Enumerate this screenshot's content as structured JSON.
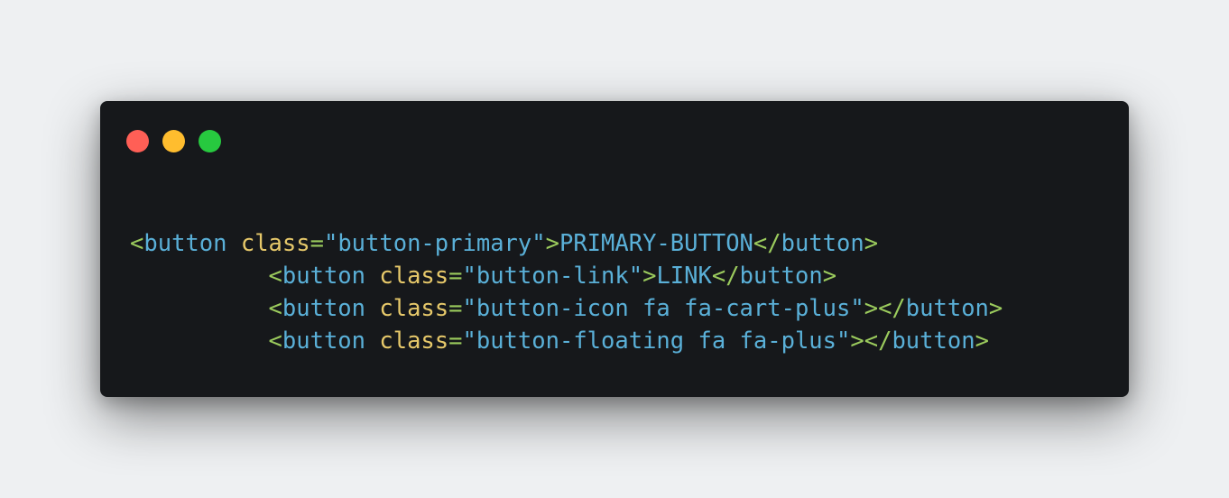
{
  "window": {
    "controls": {
      "close_color": "#ff5f56",
      "minimize_color": "#ffbd2e",
      "maximize_color": "#27c93f"
    }
  },
  "code": {
    "lines": [
      {
        "indent": "",
        "tag": "button",
        "attr": "class",
        "value": "\"button-primary\"",
        "text": "PRIMARY-BUTTON"
      },
      {
        "indent": "          ",
        "tag": "button",
        "attr": "class",
        "value": "\"button-link\"",
        "text": "LINK"
      },
      {
        "indent": "          ",
        "tag": "button",
        "attr": "class",
        "value": "\"button-icon fa fa-cart-plus\"",
        "text": ""
      },
      {
        "indent": "          ",
        "tag": "button",
        "attr": "class",
        "value": "\"button-floating fa fa-plus\"",
        "text": ""
      }
    ],
    "colors": {
      "bracket": "#9bcb5d",
      "tag": "#5ab0d8",
      "attribute": "#e6c86a",
      "string": "#5ab0d8"
    }
  }
}
